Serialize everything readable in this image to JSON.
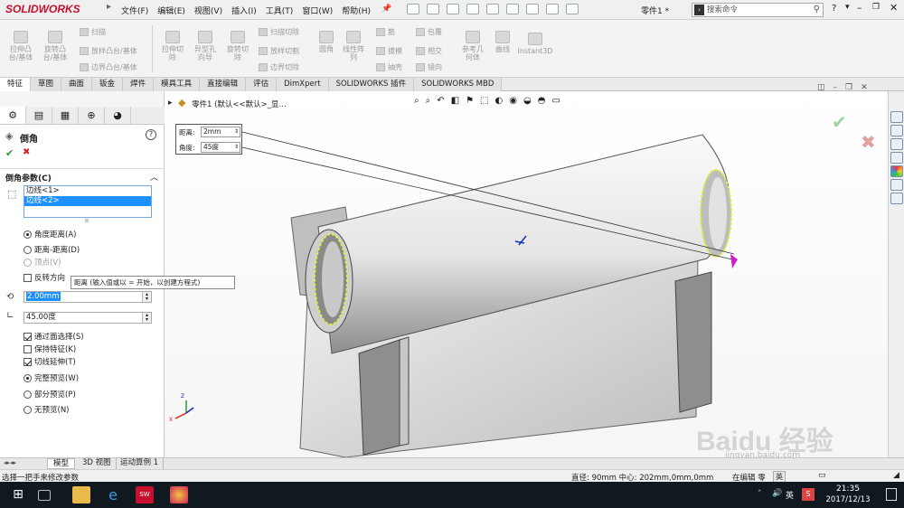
{
  "app": {
    "logo": "SOLIDWORKS",
    "doc_title": "零件1 *",
    "search_placeholder": "搜索命令"
  },
  "menus": [
    "文件(F)",
    "编辑(E)",
    "视图(V)",
    "插入(I)",
    "工具(T)",
    "窗口(W)",
    "帮助(H)"
  ],
  "commands": {
    "extrude_boss": "拉伸凸\n台/基体",
    "revolve_boss": "旋转凸\n台/基体",
    "sweep": "扫描",
    "loft": "放样凸台/基体",
    "boundary": "边界凸台/基体",
    "extrude_cut": "拉伸切\n除",
    "hole_wizard": "异型孔\n向导",
    "revolve_cut": "旋转切\n除",
    "swept_cut": "扫描切除",
    "lofted_cut": "放样切割",
    "boundary_cut": "边界切除",
    "fillet": "圆角",
    "linear_pattern": "线性阵\n列",
    "rib": "筋",
    "draft": "拔模",
    "shell": "抽壳",
    "wrap": "包覆",
    "intersect": "相交",
    "mirror": "镜向",
    "ref_geometry": "参考几\n何体",
    "curves": "曲线",
    "instant3d": "Instant3D"
  },
  "tabs": [
    "特征",
    "草图",
    "曲面",
    "钣金",
    "焊件",
    "模具工具",
    "直接编辑",
    "评估",
    "DimXpert",
    "SOLIDWORKS 插件",
    "SOLIDWORKS MBD"
  ],
  "tree_header": "零件1 (默认<<默认>_显...",
  "property_manager": {
    "title": "倒角",
    "ok": "✔",
    "cancel": "✖",
    "section_title": "倒角参数(C)",
    "edges": [
      "边线<1>",
      "边线<2>"
    ],
    "options": [
      {
        "label": "角度距离(A)",
        "checked": true
      },
      {
        "label": "距离-距离(D)",
        "checked": false
      },
      {
        "label": "顶点(V)",
        "checked": false
      }
    ],
    "reverse_direction": "反转方向",
    "tooltip": "距离 (输入值或以 = 开始，以创建方程式)",
    "distance_value": "2.00mm",
    "angle_value": "45.00度",
    "checkboxes": [
      {
        "label": "通过面选择(S)",
        "checked": true
      },
      {
        "label": "保持特征(K)",
        "checked": false
      },
      {
        "label": "切线延伸(T)",
        "checked": true
      }
    ],
    "preview": [
      {
        "label": "完整预览(W)",
        "checked": true
      },
      {
        "label": "部分预览(P)",
        "checked": false
      },
      {
        "label": "无预览(N)",
        "checked": false
      }
    ]
  },
  "callout": {
    "distance_label": "距离:",
    "distance": "2mm",
    "angle_label": "角度:",
    "angle": "45度"
  },
  "bottom_tabs": [
    "模型",
    "3D 视图",
    "运动算例 1"
  ],
  "status": {
    "hint": "选择一把手来修改参数",
    "measure": "直径: 90mm  中心: 202mm,0mm,0mm",
    "edit": "在编辑 零"
  },
  "taskbar": {
    "ime": "英",
    "time": "21:35",
    "date": "2017/12/13"
  },
  "watermark": "Baidu 经验",
  "watermark_url": "jingyan.baidu.com",
  "colors": {
    "brand": "#c8102e",
    "selection": "#1e90ff",
    "preview_edge": "#e4ee3b",
    "handle": "#d01fd0"
  }
}
